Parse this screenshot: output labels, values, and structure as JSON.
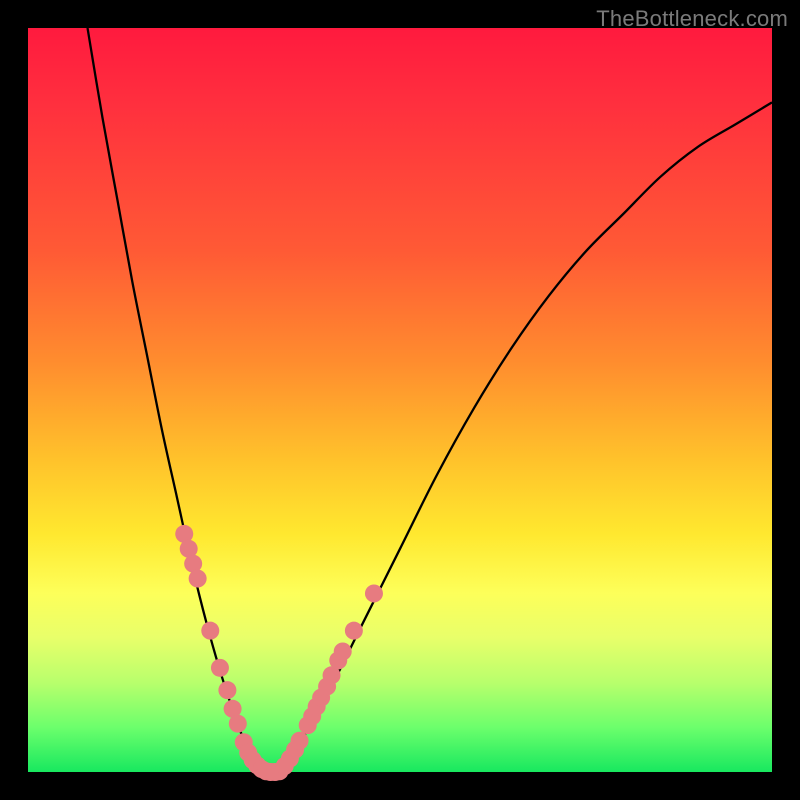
{
  "watermark": "TheBottleneck.com",
  "chart_data": {
    "type": "line",
    "title": "",
    "xlabel": "",
    "ylabel": "",
    "xlim": [
      0,
      100
    ],
    "ylim": [
      0,
      100
    ],
    "grid": false,
    "legend": false,
    "series": [
      {
        "name": "bottleneck-curve",
        "color": "#000000",
        "x": [
          8,
          10,
          12,
          14,
          16,
          18,
          20,
          22,
          24,
          26,
          28,
          30,
          32,
          34,
          36,
          40,
          45,
          50,
          55,
          60,
          65,
          70,
          75,
          80,
          85,
          90,
          95,
          100
        ],
        "values": [
          100,
          88,
          77,
          66,
          56,
          46,
          37,
          28,
          20,
          13,
          7,
          2,
          0,
          0,
          3,
          10,
          20,
          30,
          40,
          49,
          57,
          64,
          70,
          75,
          80,
          84,
          87,
          90
        ]
      }
    ],
    "markers": [
      {
        "name": "dot",
        "color": "#e77b80",
        "x": 21.0,
        "y": 32
      },
      {
        "name": "dot",
        "color": "#e77b80",
        "x": 21.6,
        "y": 30
      },
      {
        "name": "dot",
        "color": "#e77b80",
        "x": 22.2,
        "y": 28
      },
      {
        "name": "dot",
        "color": "#e77b80",
        "x": 22.8,
        "y": 26
      },
      {
        "name": "dot",
        "color": "#e77b80",
        "x": 24.5,
        "y": 19
      },
      {
        "name": "dot",
        "color": "#e77b80",
        "x": 25.8,
        "y": 14
      },
      {
        "name": "dot",
        "color": "#e77b80",
        "x": 26.8,
        "y": 11
      },
      {
        "name": "dot",
        "color": "#e77b80",
        "x": 27.5,
        "y": 8.5
      },
      {
        "name": "dot",
        "color": "#e77b80",
        "x": 28.2,
        "y": 6.5
      },
      {
        "name": "dot",
        "color": "#e77b80",
        "x": 29.0,
        "y": 4
      },
      {
        "name": "dot",
        "color": "#e77b80",
        "x": 29.6,
        "y": 2.6
      },
      {
        "name": "dot",
        "color": "#e77b80",
        "x": 30.2,
        "y": 1.6
      },
      {
        "name": "dot",
        "color": "#e77b80",
        "x": 30.8,
        "y": 0.9
      },
      {
        "name": "dot",
        "color": "#e77b80",
        "x": 31.4,
        "y": 0.4
      },
      {
        "name": "dot",
        "color": "#e77b80",
        "x": 32.0,
        "y": 0.1
      },
      {
        "name": "dot",
        "color": "#e77b80",
        "x": 32.6,
        "y": 0
      },
      {
        "name": "dot",
        "color": "#e77b80",
        "x": 33.2,
        "y": 0
      },
      {
        "name": "dot",
        "color": "#e77b80",
        "x": 33.8,
        "y": 0.1
      },
      {
        "name": "dot",
        "color": "#e77b80",
        "x": 34.5,
        "y": 0.8
      },
      {
        "name": "dot",
        "color": "#e77b80",
        "x": 35.2,
        "y": 1.8
      },
      {
        "name": "dot",
        "color": "#e77b80",
        "x": 35.9,
        "y": 3
      },
      {
        "name": "dot",
        "color": "#e77b80",
        "x": 36.5,
        "y": 4.2
      },
      {
        "name": "dot",
        "color": "#e77b80",
        "x": 37.6,
        "y": 6.3
      },
      {
        "name": "dot",
        "color": "#e77b80",
        "x": 38.2,
        "y": 7.5
      },
      {
        "name": "dot",
        "color": "#e77b80",
        "x": 38.8,
        "y": 8.8
      },
      {
        "name": "dot",
        "color": "#e77b80",
        "x": 39.4,
        "y": 10
      },
      {
        "name": "dot",
        "color": "#e77b80",
        "x": 40.2,
        "y": 11.5
      },
      {
        "name": "dot",
        "color": "#e77b80",
        "x": 40.8,
        "y": 13
      },
      {
        "name": "dot",
        "color": "#e77b80",
        "x": 41.7,
        "y": 15
      },
      {
        "name": "dot",
        "color": "#e77b80",
        "x": 42.3,
        "y": 16.2
      },
      {
        "name": "dot",
        "color": "#e77b80",
        "x": 43.8,
        "y": 19
      },
      {
        "name": "dot",
        "color": "#e77b80",
        "x": 46.5,
        "y": 24
      }
    ]
  }
}
